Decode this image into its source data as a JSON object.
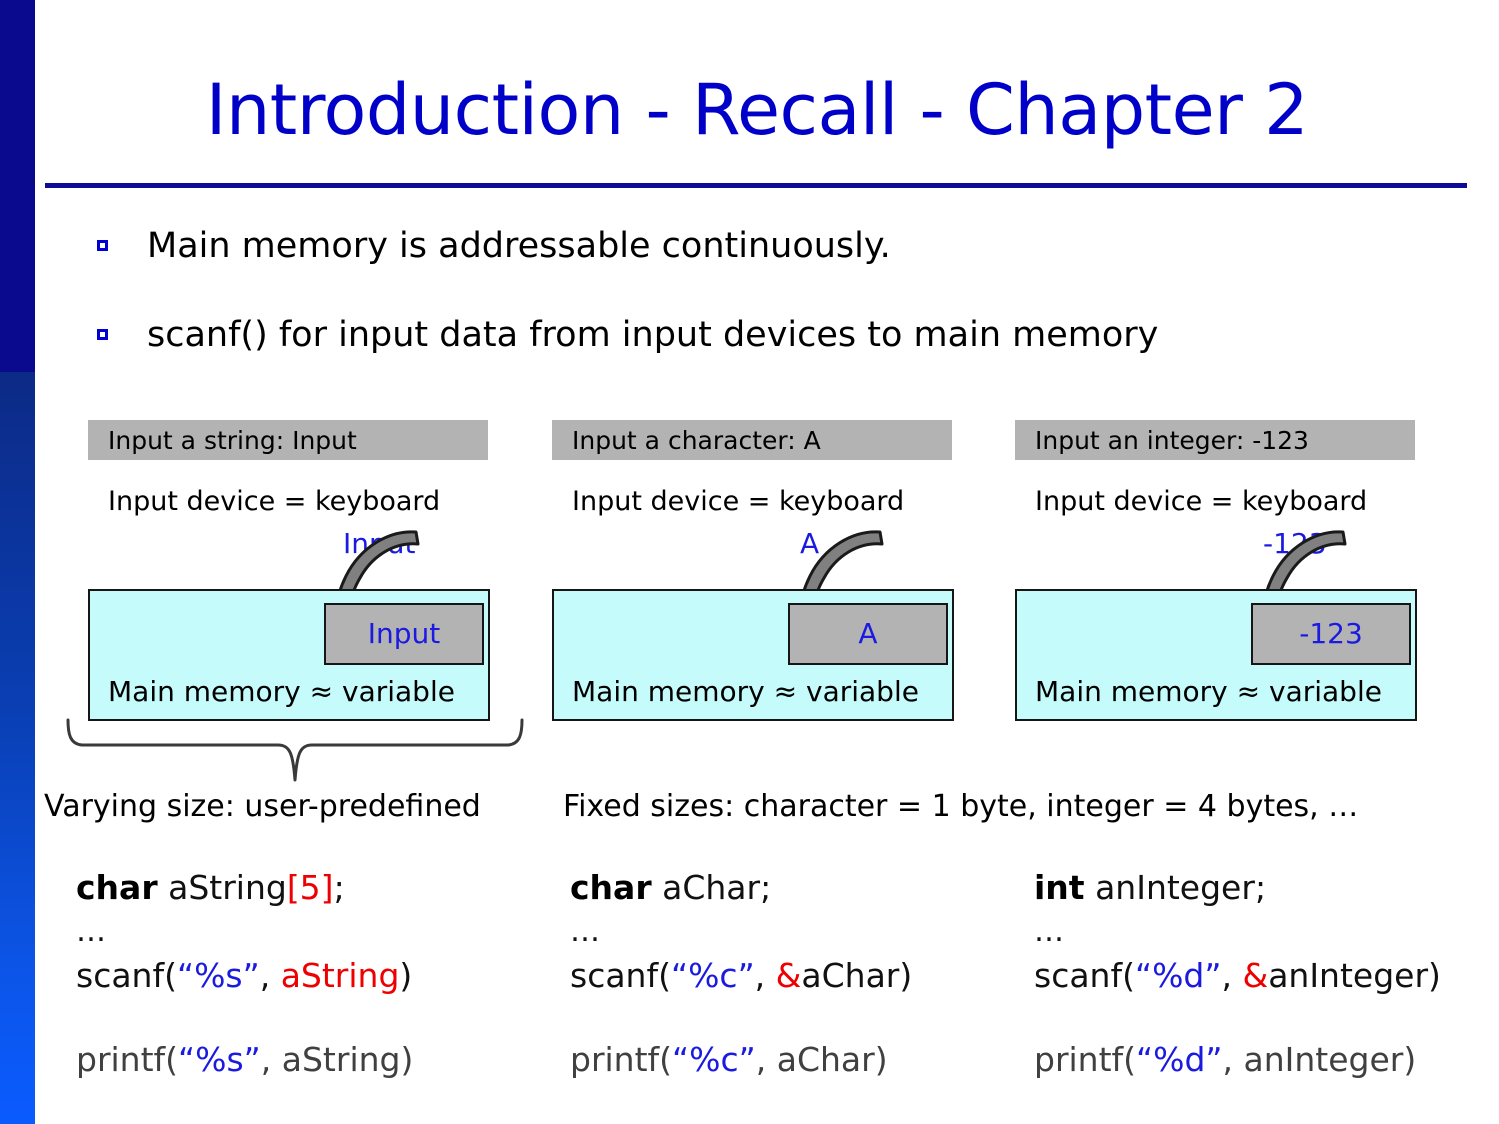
{
  "slide": {
    "title": "Introduction - Recall - Chapter 2",
    "accent_color": "#0000c8",
    "rule_color": "#0c0c96",
    "sidebar_top_color": "#0a0a8e",
    "sidebar_gradient_end": "#0a5bff"
  },
  "bullets": [
    {
      "marker": "hollow-square-bullet",
      "text": "Main memory is addressable continuously."
    },
    {
      "marker": "hollow-square-bullet",
      "text": "scanf() for input data from input devices to main memory"
    }
  ],
  "panels": [
    {
      "console_text": "Input a string: Input",
      "device_text": "Input device = keyboard",
      "flying_value": "Input",
      "variable_value": "Input",
      "memory_label": "Main memory ≈ variable",
      "arrow": "curved-arrow-down-right",
      "box_fill": "#c5fbfb",
      "bar_fill": "#b3b3b3",
      "value_color": "#1a1ae0"
    },
    {
      "console_text": "Input a character: A",
      "device_text": "Input device = keyboard",
      "flying_value": "A",
      "variable_value": "A",
      "memory_label": "Main memory ≈ variable",
      "arrow": "curved-arrow-down-right",
      "box_fill": "#c5fbfb",
      "bar_fill": "#b3b3b3",
      "value_color": "#1a1ae0"
    },
    {
      "console_text": "Input an integer: -123",
      "device_text": "Input device = keyboard",
      "flying_value": "-123",
      "variable_value": "-123",
      "memory_label": "Main memory ≈ variable",
      "arrow": "curved-arrow-down-right",
      "box_fill": "#c5fbfb",
      "bar_fill": "#b3b3b3",
      "value_color": "#1a1ae0"
    }
  ],
  "captions": {
    "left": "Varying size: user-predefined",
    "right": "Fixed sizes: character = 1 byte, integer = 4 bytes, …"
  },
  "code_columns": [
    {
      "declaration": {
        "keyword": "char",
        "name": " aString",
        "index": "[5]",
        "terminator": ";"
      },
      "ellipsis": "…",
      "scanf": {
        "call": "scanf(",
        "format": "“%s”",
        "sep": ", ",
        "amp": "",
        "arg": "aString",
        "close": ")",
        "arg_color": "red"
      },
      "printf": {
        "call": "printf(",
        "format": "“%s”",
        "sep": ", ",
        "arg": "aString",
        "close": ")"
      }
    },
    {
      "declaration": {
        "keyword": "char",
        "name": " aChar",
        "index": "",
        "terminator": ";"
      },
      "ellipsis": "…",
      "scanf": {
        "call": "scanf(",
        "format": "“%c”",
        "sep": ", ",
        "amp": "&",
        "arg": "aChar",
        "close": ")",
        "arg_color": "black"
      },
      "printf": {
        "call": "printf(",
        "format": "“%c”",
        "sep": ", ",
        "arg": "aChar",
        "close": ")"
      }
    },
    {
      "declaration": {
        "keyword": "int",
        "name": " anInteger",
        "index": "",
        "terminator": ";"
      },
      "ellipsis": "…",
      "scanf": {
        "call": "scanf(",
        "format": "“%d”",
        "sep": ", ",
        "amp": "&",
        "arg": "anInteger",
        "close": ")",
        "arg_color": "black"
      },
      "printf": {
        "call": "printf(",
        "format": "“%d”",
        "sep": ", ",
        "arg": "anInteger",
        "close": ")"
      }
    }
  ],
  "colors": {
    "code_keyword": "#000000",
    "code_red": "#ee0000",
    "code_blue": "#1a1ae0",
    "printf_gray": "#404040",
    "arrow_fill": "#808080",
    "arrow_stroke": "#1a1a1a",
    "brace_stroke": "#3a3a3a"
  }
}
